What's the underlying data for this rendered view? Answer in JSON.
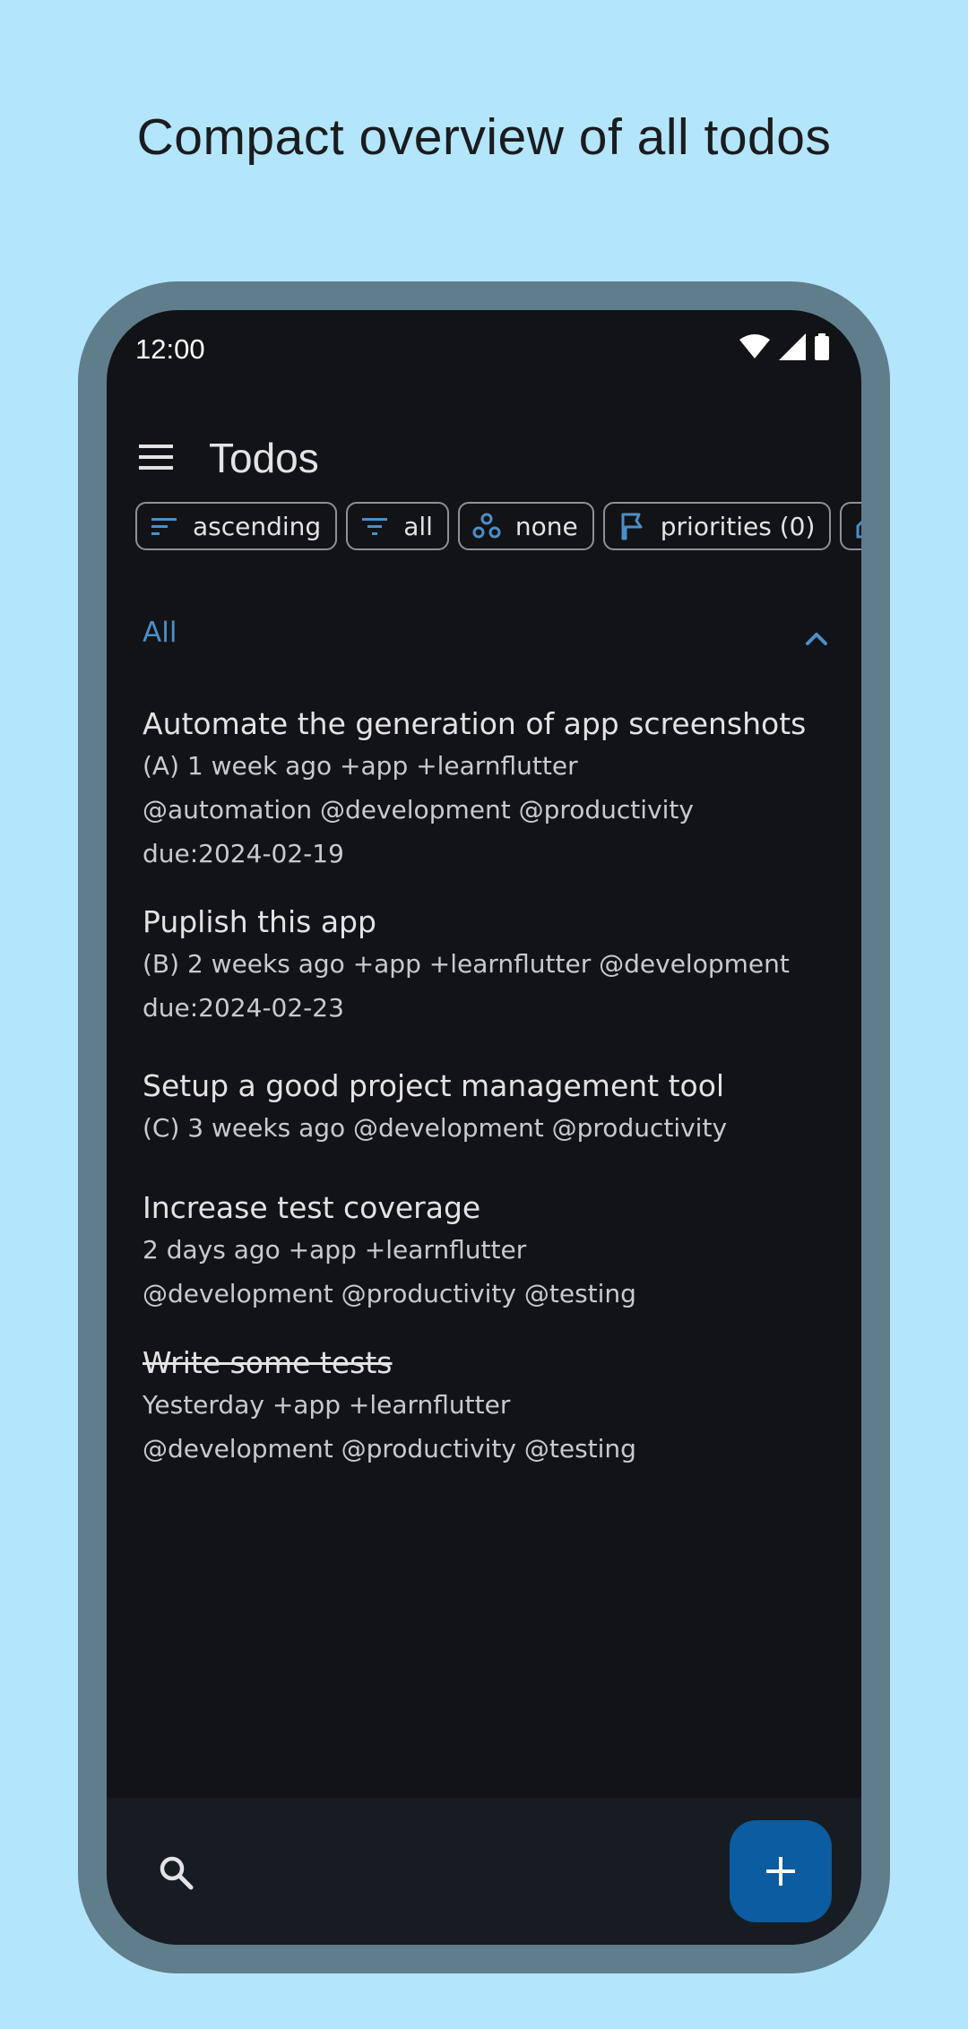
{
  "headline": "Compact overview of all todos",
  "status_bar": {
    "time": "12:00",
    "icons": [
      "wifi-icon",
      "signal-icon",
      "battery-icon"
    ]
  },
  "app_bar": {
    "menu_icon": "menu-icon",
    "title": "Todos"
  },
  "filter_chips": [
    {
      "icon": "sort-icon",
      "label": "ascending"
    },
    {
      "icon": "filter-icon",
      "label": "all"
    },
    {
      "icon": "group-icon",
      "label": "none"
    },
    {
      "icon": "flag-icon",
      "label": "priorities (0)"
    }
  ],
  "section": {
    "label": "All",
    "toggle_icon": "chevron-up-icon"
  },
  "todos": [
    {
      "title": "Automate the generation of app screenshots",
      "lines": [
        "(A) 1 week ago +app +learnflutter",
        "@automation @development @productivity",
        "due:2024-02-19"
      ],
      "completed": false
    },
    {
      "title": "Puplish this app",
      "lines": [
        "(B) 2 weeks ago +app +learnflutter @development",
        "due:2024-02-23"
      ],
      "completed": false
    },
    {
      "title": "Setup a good project management tool",
      "lines": [
        "(C) 3 weeks ago @development @productivity"
      ],
      "completed": false
    },
    {
      "title": "Increase test coverage",
      "lines": [
        "2 days ago +app +learnflutter",
        "@development @productivity @testing"
      ],
      "completed": false
    },
    {
      "title": "Write some tests",
      "lines": [
        "Yesterday +app +learnflutter",
        "@development @productivity @testing"
      ],
      "completed": true
    }
  ],
  "bottom_bar": {
    "search_icon": "search-icon",
    "fab_icon": "add-icon"
  },
  "colors": {
    "background": "#b3e5fc",
    "frame": "#607d8b",
    "screen": "#121316",
    "accent": "#4b8fc9",
    "fab": "#0b5ca0"
  }
}
